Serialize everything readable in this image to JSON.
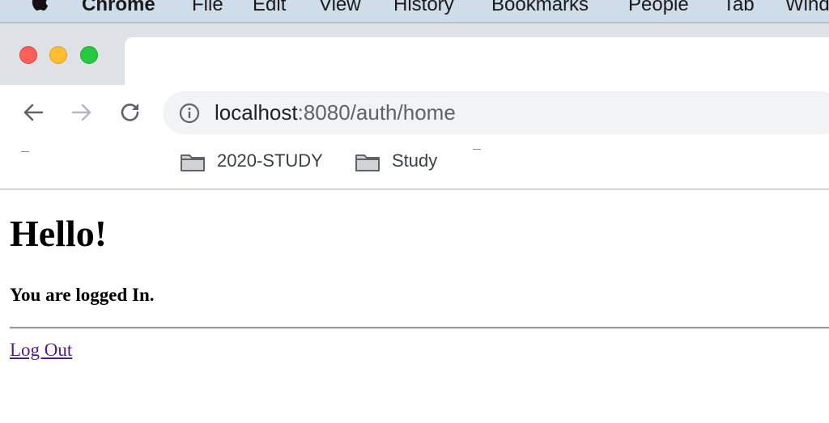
{
  "menubar": {
    "items": [
      "Chrome",
      "File",
      "Edit",
      "View",
      "History",
      "Bookmarks",
      "People",
      "Tab",
      "Window"
    ]
  },
  "toolbar": {
    "url_host": "localhost",
    "url_path": ":8080/auth/home"
  },
  "bookmarks": [
    {
      "label": "2020-STUDY",
      "icon": "folder-icon"
    },
    {
      "label": "Study",
      "icon": "folder-icon"
    }
  ],
  "page": {
    "title": "Hello!",
    "subtitle": "You are logged In.",
    "logout_link": "Log Out"
  },
  "colors": {
    "menubar_bg": "#cfdcea",
    "tabstrip_bg": "#dee1e6",
    "omnibox_bg": "#f1f3f4",
    "visited_link": "#551a8b",
    "traffic_close": "#fe5f57",
    "traffic_minimize": "#febc2e",
    "traffic_maximize": "#28c840"
  }
}
